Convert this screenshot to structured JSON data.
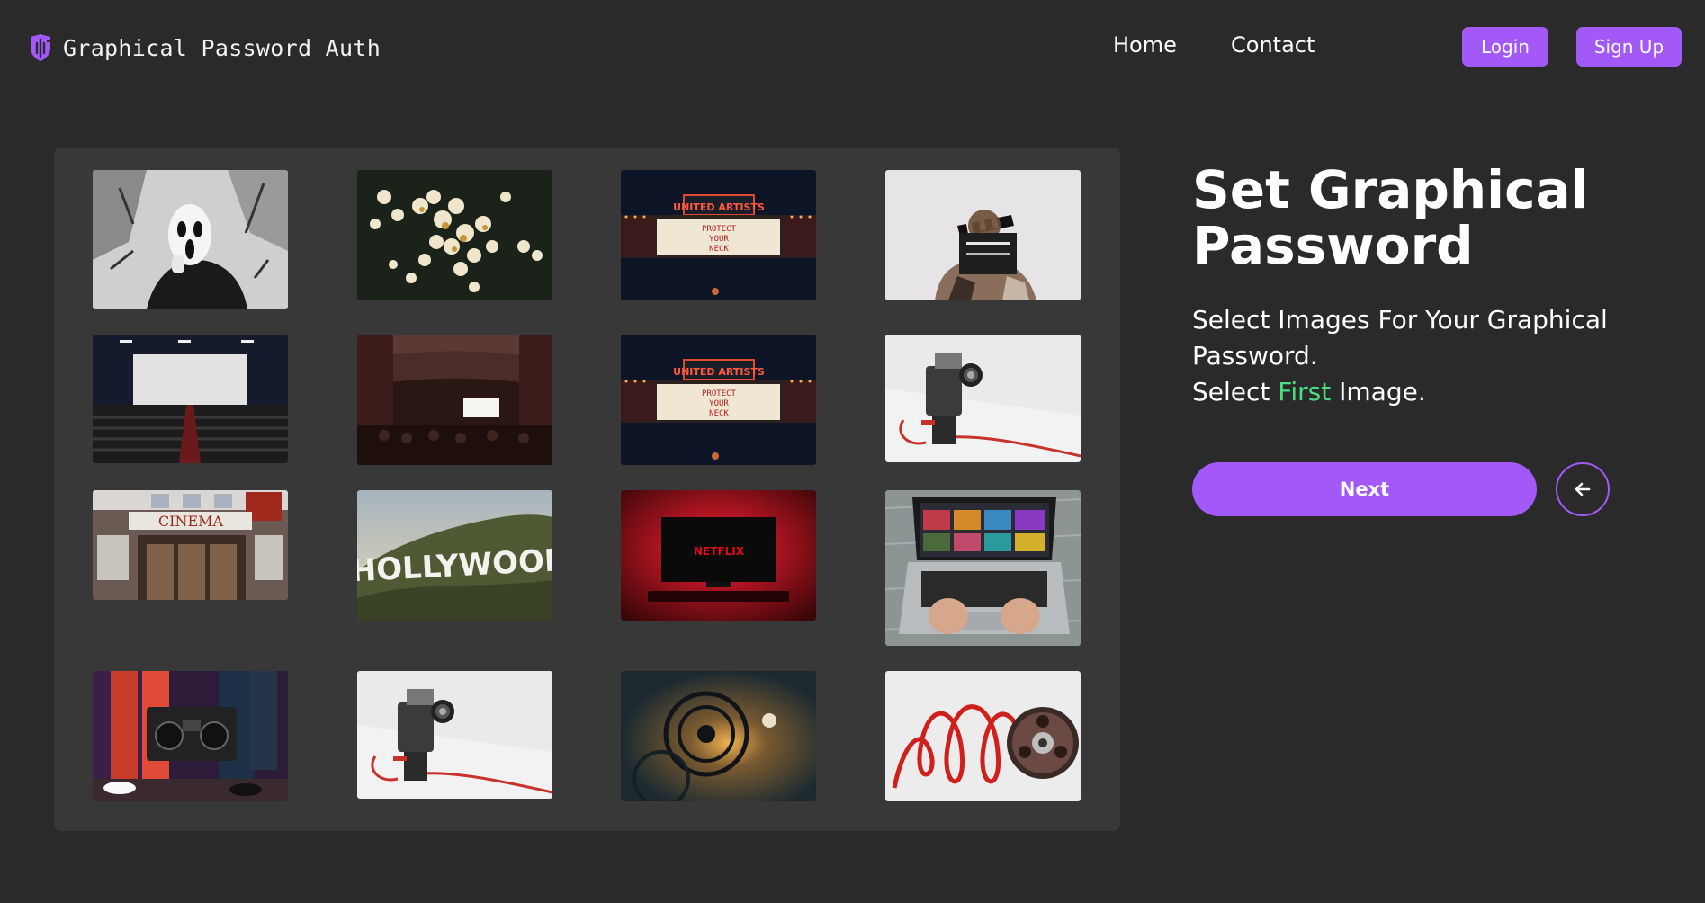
{
  "nav": {
    "brand": "Graphical Password Auth",
    "links": [
      "Home",
      "Contact"
    ],
    "login_label": "Login",
    "signup_label": "Sign Up"
  },
  "main": {
    "heading": "Set Graphical Password",
    "instruction_line1": "Select Images For Your Graphical Password.",
    "select_prefix": "Select",
    "select_ordinal": "First",
    "select_suffix": "Image.",
    "next_label": "Next"
  },
  "images": [
    {
      "name": "ghostface-mask"
    },
    {
      "name": "popcorn"
    },
    {
      "name": "united-artists-marquee"
    },
    {
      "name": "clapperboard"
    },
    {
      "name": "empty-cinema-screen"
    },
    {
      "name": "theater-audience"
    },
    {
      "name": "united-artists-marquee"
    },
    {
      "name": "vintage-film-camera"
    },
    {
      "name": "cinema-storefront"
    },
    {
      "name": "hollywood-sign"
    },
    {
      "name": "netflix-tv"
    },
    {
      "name": "laptop-streaming"
    },
    {
      "name": "boombox-dancers"
    },
    {
      "name": "vintage-film-camera"
    },
    {
      "name": "film-reel-light"
    },
    {
      "name": "film-reel-red"
    }
  ],
  "image_text": {
    "marquee_brand": "UNITED ARTISTS",
    "marquee_line1": "PROTECT",
    "marquee_line2": "YOUR",
    "marquee_line3": "NECK",
    "cinema_sign": "CINEMA",
    "hollywood_sign": "HOLLYWOOD",
    "netflix_logo": "NETFLIX"
  },
  "colors": {
    "background": "#2a2a2a",
    "panel": "#383838",
    "accent": "#a259f7",
    "highlight": "#4ade80"
  }
}
